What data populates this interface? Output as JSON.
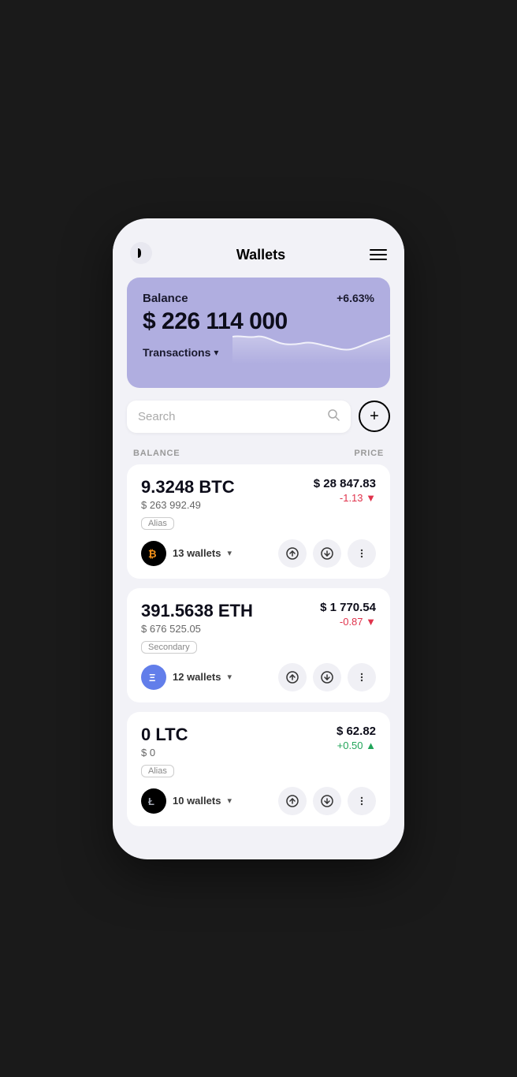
{
  "header": {
    "title": "Wallets",
    "logo_alt": "app-logo",
    "menu_label": "Menu"
  },
  "balance_card": {
    "label": "Balance",
    "amount": "$ 226 114 000",
    "change": "+6.63%",
    "transactions_label": "Transactions"
  },
  "search": {
    "placeholder": "Search"
  },
  "table_headers": {
    "balance": "BALANCE",
    "price": "PRICE"
  },
  "add_button_label": "+",
  "coins": [
    {
      "amount": "9.3248 BTC",
      "usd_value": "$ 263 992.49",
      "price": "$ 28 847.83",
      "change": "-1.13",
      "change_positive": false,
      "alias": "Alias",
      "wallets": "13 wallets",
      "logo_symbol": "₿",
      "logo_class": "btc-logo"
    },
    {
      "amount": "391.5638 ETH",
      "usd_value": "$ 676 525.05",
      "price": "$ 1 770.54",
      "change": "-0.87",
      "change_positive": false,
      "alias": "Secondary",
      "wallets": "12 wallets",
      "logo_symbol": "Ξ",
      "logo_class": "eth-logo"
    },
    {
      "amount": "0 LTC",
      "usd_value": "$ 0",
      "price": "$ 62.82",
      "change": "+0.50",
      "change_positive": true,
      "alias": "Alias",
      "wallets": "10 wallets",
      "logo_symbol": "Ł",
      "logo_class": "ltc-logo"
    }
  ]
}
